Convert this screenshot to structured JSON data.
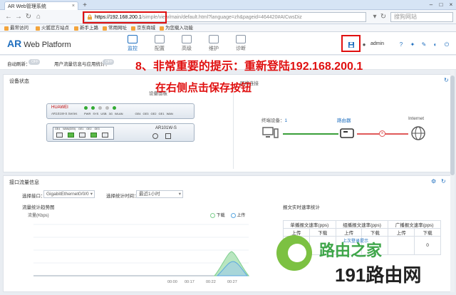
{
  "browser": {
    "tab_title": "AR Web管理系统",
    "url_host": "https://192.168.200.1",
    "url_rest": "/simple/view/main/default.html?language=zh&pageid=464420#AICwsDiz",
    "search_placeholder": "搜狗网站",
    "bookmarks": [
      "最常访问",
      "火狐官方站点",
      "新手上路",
      "常用网址",
      "京东商城",
      "为您载入功能"
    ]
  },
  "app": {
    "logo_ar": "AR",
    "logo_rest": "Web Platform",
    "nav": [
      "监控",
      "配置",
      "高级",
      "维护",
      "诊断"
    ],
    "user": "admin"
  },
  "refresh": {
    "auto_label": "自动刷新：",
    "auto_value": "OFF",
    "stats_label": "用户流量信息与应用统计：",
    "stats_value": "OFF"
  },
  "annotation": {
    "line1": "8、非常重要的提示：重新登陆192.168.200.1",
    "line2": "在右侧点击保存按钮"
  },
  "device_panel": {
    "title": "设备状态",
    "device_caption": "设备面板",
    "topo_caption": "网络连接",
    "brand": "HUAWEI",
    "model_small": "AR101W-S Series",
    "model": "AR101W-S",
    "ports_top": [
      "PWR",
      "SYS",
      "USB",
      "3G",
      "WLAN",
      "GE4",
      "GE3",
      "GE2",
      "GE1",
      "WAN"
    ],
    "ports_bottom": [
      "GE4",
      "WAN(GE0)",
      "GE1",
      "GE2",
      "GE3"
    ],
    "terminal_label": "终端设备：",
    "terminal_count": "1",
    "router_label": "路由器",
    "internet_label": "Internet"
  },
  "traffic_panel": {
    "title": "接口流量信息",
    "iface_label": "选择接口：",
    "iface_value": "GigabitEthernet0/0/0",
    "period_label": "选择统计时间：",
    "period_value": "最近1小时",
    "chart_title": "流量统计趋势图",
    "y_label": "流量(Kbps)",
    "legend_down": "下载",
    "legend_up": "上传",
    "x_ticks": [
      "00:00",
      "00:17",
      "00:22",
      "00:27"
    ],
    "rate_title": "报文实时速率统计",
    "rate_headers": [
      "单播报文速率(pps)",
      "组播报文速率(pps)",
      "广播报文速率(pps)"
    ],
    "rate_sub": [
      "上传",
      "下载",
      "上传",
      "下载",
      "上传",
      "下载"
    ],
    "rate_row": [
      "0",
      "",
      "",
      "",
      "",
      "0"
    ],
    "hint": "上次登录提示"
  },
  "watermark": {
    "line1": "路由之家",
    "line2": "191路由网"
  },
  "chart_data": {
    "type": "area",
    "title": "流量统计趋势图",
    "ylabel": "流量(Kbps)",
    "x": [
      "00:00",
      "00:17",
      "00:22",
      "00:27"
    ],
    "series": [
      {
        "name": "下载",
        "values": [
          0,
          0,
          0,
          0
        ]
      },
      {
        "name": "上传",
        "values": [
          0,
          0,
          0,
          0
        ]
      }
    ],
    "legend": "top-right",
    "colors": {
      "下载": "#7fcf8f",
      "上传": "#5aa7e0"
    }
  },
  "colors": {
    "accent": "#1f6fbf",
    "highlight": "#e01010"
  }
}
